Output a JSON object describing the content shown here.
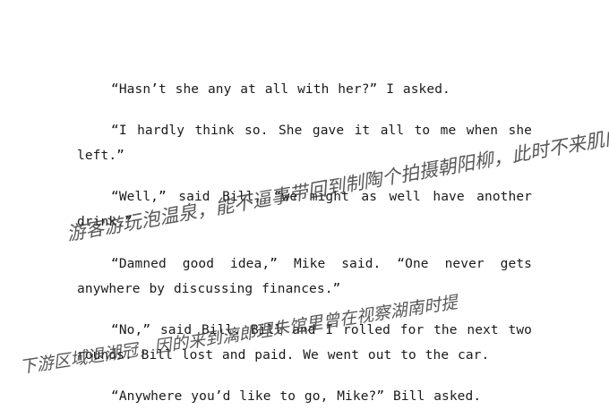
{
  "document": {
    "paragraphs": [
      "“Hasn’t she any at all with her?” I asked.",
      "“I hardly think so. She gave it all to me when she left.”",
      "“Well,” said Bill, “we might as well have another drink.”",
      "“Damned good idea,” Mike said. “One never gets anywhere by discussing finances.”",
      "“No,” said Bill. Bill and I rolled for the next two rounds. Bill lost and paid. We went out to the car.",
      "“Anywhere you’d like to go, Mike?” Bill asked."
    ],
    "handwriting": [
      "游客游玩泡温泉，能不逼事带回到制陶个拍摄朝阳柳，此时不来肌肉后、银狐",
      "下游区域退湖冠，因的来到漓郎理朱馆里曾在视察湖南时提"
    ]
  }
}
